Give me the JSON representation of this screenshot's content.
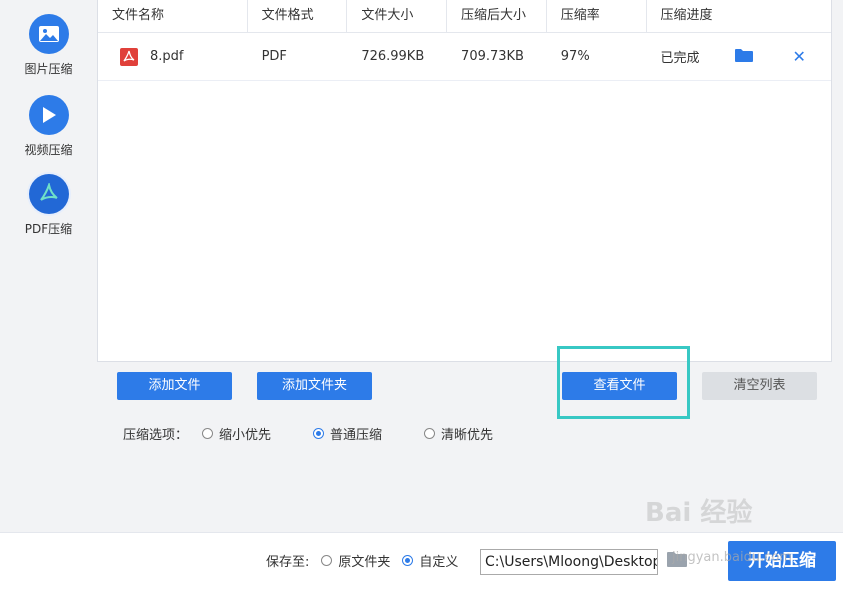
{
  "sidebar": {
    "items": [
      {
        "label": "图片压缩",
        "icon": "image-icon"
      },
      {
        "label": "视频压缩",
        "icon": "play-icon"
      },
      {
        "label": "PDF压缩",
        "icon": "pdf-acrobat-icon",
        "active": true
      }
    ]
  },
  "table": {
    "headers": [
      "文件名称",
      "文件格式",
      "文件大小",
      "压缩后大小",
      "压缩率",
      "压缩进度"
    ],
    "rows": [
      {
        "name": "8.pdf",
        "format": "PDF",
        "size": "726.99KB",
        "compressed": "709.73KB",
        "ratio": "97%",
        "status": "已完成"
      }
    ]
  },
  "buttons": {
    "add_file": "添加文件",
    "add_folder": "添加文件夹",
    "view_file": "查看文件",
    "clear_list": "清空列表",
    "start": "开始压缩"
  },
  "options": {
    "label": "压缩选项：",
    "items": [
      "缩小优先",
      "普通压缩",
      "清晰优先"
    ],
    "selected": "普通压缩"
  },
  "save": {
    "label": "保存至:",
    "items": [
      "原文件夹",
      "自定义"
    ],
    "selected": "自定义",
    "path": "C:\\Users\\Mloong\\Desktop"
  },
  "watermark": {
    "text": "Bai 经验",
    "sub": "jingyan.baidu.com"
  },
  "colors": {
    "accent": "#2d7be8",
    "highlight": "#38c8c4",
    "disabled": "#dcdfe3"
  }
}
